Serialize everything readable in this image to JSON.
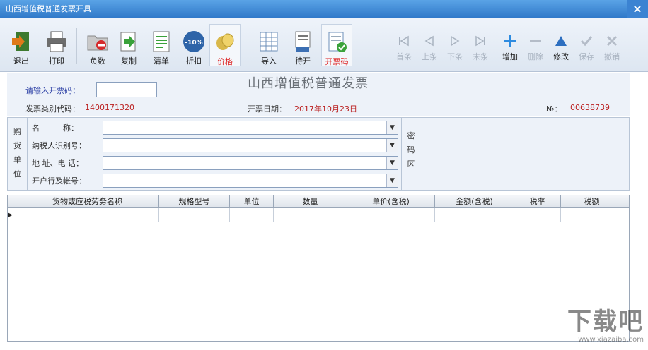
{
  "window": {
    "title": "山西增值税普通发票开具",
    "close": "×"
  },
  "toolbar": {
    "exit": "退出",
    "print": "打印",
    "negative": "负数",
    "copy": "复制",
    "list": "清单",
    "discount": "折扣",
    "discount_badge": "-10%",
    "price": "价格",
    "import": "导入",
    "pending": "待开",
    "issue_code": "开票码",
    "nav": {
      "first": "首条",
      "prev": "上条",
      "next": "下条",
      "last": "末条",
      "add": "增加",
      "delete": "删除",
      "edit": "修改",
      "save": "保存",
      "cancel": "撤销"
    }
  },
  "header": {
    "invoice_title": "山西增值税普通发票",
    "input_code_label": "请输入开票码：",
    "input_code_value": "",
    "type_code_label": "发票类别代码：",
    "type_code_value": "1400171320",
    "date_label": "开票日期：",
    "date_value": "2017年10月23日",
    "number_label": "№：",
    "number_value": "00638739"
  },
  "buyer": {
    "section_chars": [
      "购",
      "货",
      "单",
      "位"
    ],
    "name_label": "名　　　称：",
    "taxid_label": "纳税人识别号：",
    "addr_label": "地 址、电 话：",
    "bank_label": "开户行及帐号：",
    "name_value": "",
    "taxid_value": "",
    "addr_value": "",
    "bank_value": "",
    "password_chars": [
      "密",
      "码",
      "区"
    ]
  },
  "grid": {
    "columns": [
      "货物或应税劳务名称",
      "规格型号",
      "单位",
      "数量",
      "单价(含税)",
      "金额(含税)",
      "税率",
      "税额"
    ],
    "row_indicator": "▶"
  },
  "watermark": {
    "main": "下载吧",
    "sub": "www.xiazaiba.com"
  },
  "colors": {
    "titlebar": "#2f78c8",
    "accent_red": "#d22222",
    "label_blue": "#2b3fa5"
  }
}
